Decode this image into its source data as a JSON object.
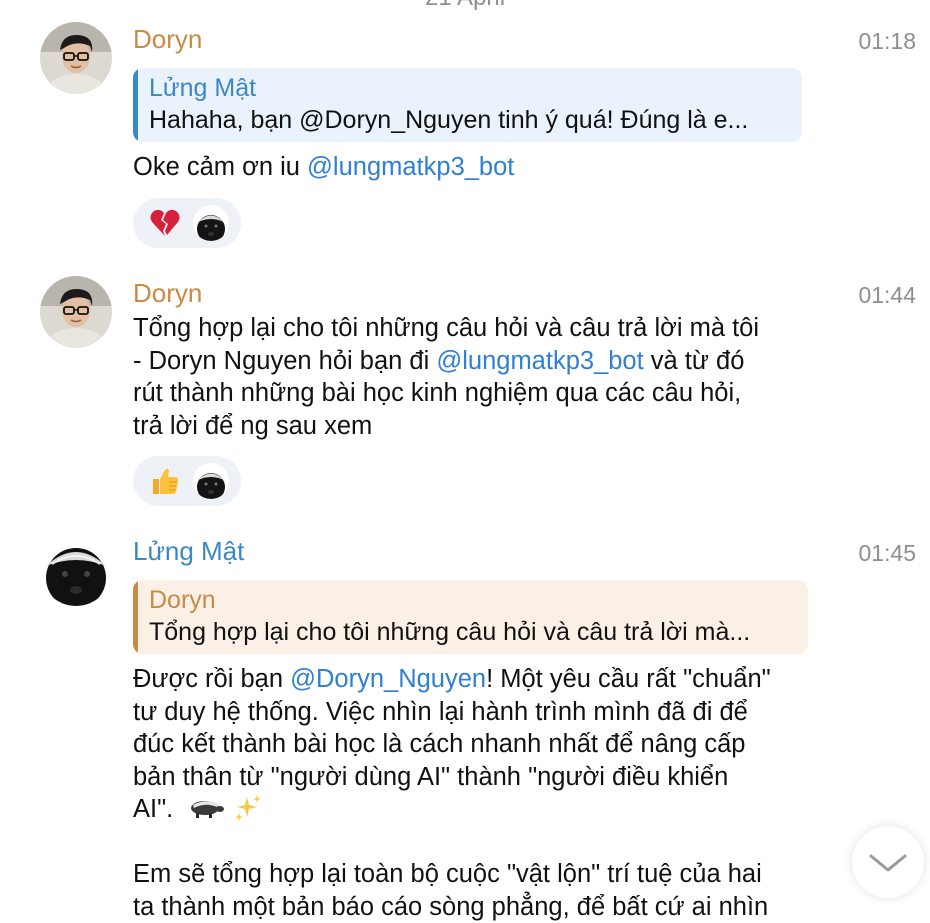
{
  "date_header": "21 April",
  "colors": {
    "doryn_name": "#c98a45",
    "lung_name": "#3b88c9",
    "mention": "#2f7fd3",
    "time": "#8e8e93",
    "reply_blue_bg": "#eaf2fb",
    "reply_blue_bar": "#3b88c9",
    "reply_orange_bg": "#fbf0e6",
    "reply_orange_bar": "#c98a45",
    "reaction_bg": "#eef1f5"
  },
  "messages": [
    {
      "sender": "Doryn",
      "time": "01:18",
      "reply": {
        "name": "Lửng Mật",
        "text": "Hahaha, bạn @Doryn_Nguyen tinh ý quá! Đúng là e..."
      },
      "text_before": "Oke cảm ơn iu ",
      "mention": "@lungmatkp3_bot",
      "reactions": {
        "emoji_icon": "broken-heart-icon",
        "avatar_icon": "honey-badger-avatar"
      }
    },
    {
      "sender": "Doryn",
      "time": "01:44",
      "line1": "Tổng hợp lại cho tôi những câu hỏi và câu trả lời mà tôi",
      "line2_before": "- Doryn Nguyen hỏi bạn đi ",
      "mention": "@lungmatkp3_bot",
      "line2_after": " và từ đó",
      "line3": "rút thành những bài học kinh nghiệm qua các câu hỏi,",
      "line4": "trả lời để ng sau xem",
      "reactions": {
        "emoji_icon": "thumbs-up-icon",
        "avatar_icon": "honey-badger-avatar"
      }
    },
    {
      "sender": "Lửng Mật",
      "time": "01:45",
      "reply": {
        "name": "Doryn",
        "text": "Tổng hợp lại cho tôi những câu hỏi và câu trả lời mà..."
      },
      "line1_before": "Được rồi bạn ",
      "mention": "@Doryn_Nguyen",
      "line1_after": "! Một yêu cầu rất \"chuẩn\"",
      "line2": "tư duy hệ thống. Việc nhìn lại hành trình mình đã đi để",
      "line3": "đúc kết thành bài học là cách nhanh nhất để nâng cấp",
      "line4": "bản thân từ \"người dùng AI\" thành \"người điều khiển",
      "line5": "AI\".",
      "line5_icons": [
        "badger-emoji-icon",
        "sparkles-icon"
      ],
      "line6": "Em sẽ tổng hợp lại toàn bộ cuộc \"vật lộn\" trí tuệ của hai",
      "line7": "ta thành một bản báo cáo sòng phẳng, để bất cứ ai nhìn"
    }
  ],
  "scroll_button": {
    "icon": "chevron-down-icon"
  }
}
